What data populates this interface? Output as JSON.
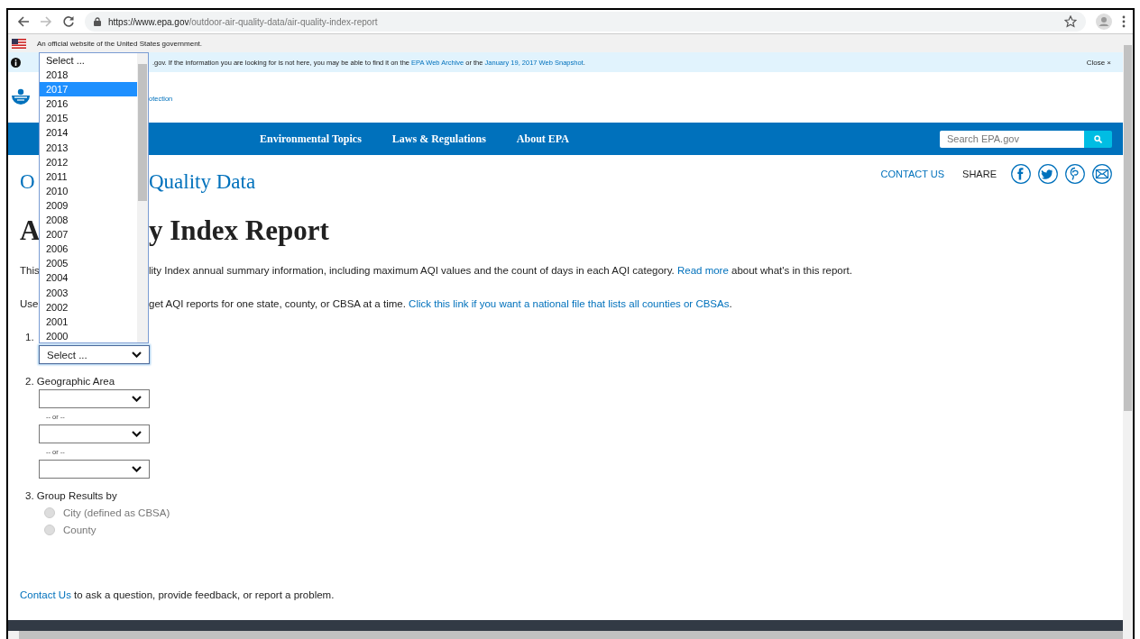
{
  "browser": {
    "url_host": "https://www.epa.gov",
    "url_path": "/outdoor-air-quality-data/air-quality-index-report"
  },
  "gov_banner": {
    "text": "An official website of the United States government."
  },
  "info_bar": {
    "segments": [
      {
        "kind": "text",
        "text": ".gov. If the information you are looking for is not here, you may be able to find it on the "
      },
      {
        "kind": "link",
        "text": "EPA Web Archive"
      },
      {
        "kind": "text",
        "text": " or the "
      },
      {
        "kind": "link",
        "text": "January 19, 2017 Web Snapshot"
      },
      {
        "kind": "text",
        "text": "."
      }
    ],
    "close": "Close ×"
  },
  "logo": {
    "text_fragment": "otection"
  },
  "nav": {
    "items": [
      "Environmental Topics",
      "Laws & Regulations",
      "About EPA"
    ],
    "search_placeholder": "Search EPA.gov"
  },
  "utility": {
    "contact": "CONTACT US",
    "share": "SHARE"
  },
  "section_title": {
    "left": "O",
    "right": "Quality Data"
  },
  "page_title": {
    "left": "A",
    "right": "y Index Report"
  },
  "paragraphs": [
    {
      "left": "This",
      "segments": [
        {
          "kind": "text",
          "text": "lity Index annual summary information, including maximum AQI values and the count of days in each AQI category. "
        },
        {
          "kind": "link",
          "text": "Read more"
        },
        {
          "kind": "text",
          "text": " about what's in this report."
        }
      ]
    },
    {
      "left": "Use",
      "segments": [
        {
          "kind": "text",
          "text": "get AQI reports for one state, county, or CBSA at a time. "
        },
        {
          "kind": "link",
          "text": "Click this link if you want a national file that lists all counties or CBSAs"
        },
        {
          "kind": "text",
          "text": "."
        }
      ]
    }
  ],
  "step1": {
    "label": "1.",
    "select": {
      "value": "Select ...",
      "focused": true
    }
  },
  "year_dropdown": {
    "options": [
      {
        "label": "Select ...",
        "selected": false
      },
      {
        "label": "2018",
        "selected": false
      },
      {
        "label": "2017",
        "selected": true
      },
      {
        "label": "2016",
        "selected": false
      },
      {
        "label": "2015",
        "selected": false
      },
      {
        "label": "2014",
        "selected": false
      },
      {
        "label": "2013",
        "selected": false
      },
      {
        "label": "2012",
        "selected": false
      },
      {
        "label": "2011",
        "selected": false
      },
      {
        "label": "2010",
        "selected": false
      },
      {
        "label": "2009",
        "selected": false
      },
      {
        "label": "2008",
        "selected": false
      },
      {
        "label": "2007",
        "selected": false
      },
      {
        "label": "2006",
        "selected": false
      },
      {
        "label": "2005",
        "selected": false
      },
      {
        "label": "2004",
        "selected": false
      },
      {
        "label": "2003",
        "selected": false
      },
      {
        "label": "2002",
        "selected": false
      },
      {
        "label": "2001",
        "selected": false
      },
      {
        "label": "2000",
        "selected": false
      }
    ]
  },
  "step2": {
    "label": "2. Geographic Area",
    "items": [
      {
        "kind": "select"
      },
      {
        "kind": "separator",
        "text": "-- or --"
      },
      {
        "kind": "select"
      },
      {
        "kind": "separator",
        "text": "-- or --"
      },
      {
        "kind": "select"
      }
    ]
  },
  "step3": {
    "label": "3. Group Results by",
    "options": [
      {
        "label": "City (defined as CBSA)",
        "checked": false,
        "disabled": true
      },
      {
        "label": "County",
        "checked": false,
        "disabled": true
      }
    ]
  },
  "feedback": {
    "segments": [
      {
        "kind": "link",
        "text": "Contact Us"
      },
      {
        "kind": "text",
        "text": " to ask a question, provide feedback, or report a problem."
      }
    ]
  }
}
